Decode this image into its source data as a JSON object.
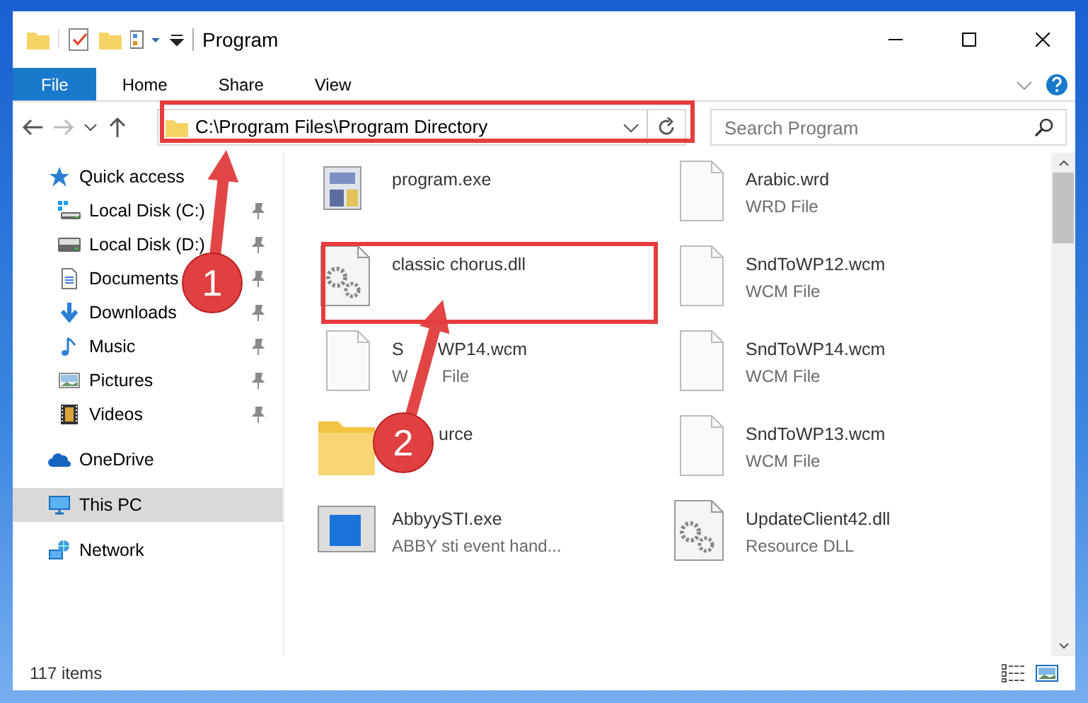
{
  "window": {
    "title": "Program"
  },
  "ribbon_tabs": [
    {
      "label": "File",
      "kind": "file"
    },
    {
      "label": "Home",
      "kind": "tab"
    },
    {
      "label": "Share",
      "kind": "tab"
    },
    {
      "label": "View",
      "kind": "tab"
    }
  ],
  "address": {
    "path": "C:\\Program Files\\Program Directory"
  },
  "search": {
    "placeholder": "Search Program"
  },
  "sidebar": {
    "items": [
      {
        "label": "Quick access",
        "kind": "star",
        "selected": false,
        "children": [
          {
            "label": "Local Disk (C:)",
            "kind": "drive-win",
            "pinned": true,
            "selected": false
          },
          {
            "label": "Local Disk (D:)",
            "kind": "drive",
            "pinned": true,
            "selected": false
          },
          {
            "label": "Documents",
            "kind": "document",
            "pinned": true,
            "selected": false
          },
          {
            "label": "Downloads",
            "kind": "download",
            "pinned": true,
            "selected": false
          },
          {
            "label": "Music",
            "kind": "music",
            "pinned": true,
            "selected": false
          },
          {
            "label": "Pictures",
            "kind": "pictures",
            "pinned": true,
            "selected": false
          },
          {
            "label": "Videos",
            "kind": "videos",
            "pinned": true,
            "selected": false
          }
        ]
      },
      {
        "label": "OneDrive",
        "kind": "cloud",
        "selected": false
      },
      {
        "label": "This PC",
        "kind": "pc",
        "selected": true
      },
      {
        "label": "Network",
        "kind": "network",
        "selected": false
      }
    ]
  },
  "files": [
    {
      "name": [
        "program.exe"
      ],
      "kind": "exe"
    },
    {
      "name": [
        "Arabic.wrd"
      ],
      "type": [
        "WRD File"
      ],
      "kind": "blank"
    },
    {
      "name": [
        "classic chorus.dll"
      ],
      "kind": "dll"
    },
    {
      "name": [
        "SndToWP12.wcm"
      ],
      "type": [
        "WCM File"
      ],
      "kind": "blank"
    },
    {
      "name": [
        "S",
        "WP14.wcm"
      ],
      "type": [
        "W",
        "File"
      ],
      "kind": "blank"
    },
    {
      "name": [
        "SndToWP14.wcm"
      ],
      "type": [
        "WCM File"
      ],
      "kind": "blank"
    },
    {
      "name": [
        "urce"
      ],
      "kind": "folder",
      "covered_start": true
    },
    {
      "name": [
        "SndToWP13.wcm"
      ],
      "type": [
        "WCM File"
      ],
      "kind": "blank"
    },
    {
      "name": [
        "AbbyySTI.exe"
      ],
      "type": [
        "ABBY sti event hand..."
      ],
      "kind": "app"
    },
    {
      "name": [
        "UpdateClient42.dll"
      ],
      "type": [
        "Resource DLL"
      ],
      "kind": "dll"
    }
  ],
  "status_bar": {
    "count": "117 items"
  },
  "annotations": [
    {
      "label": "1"
    },
    {
      "label": "2"
    }
  ]
}
